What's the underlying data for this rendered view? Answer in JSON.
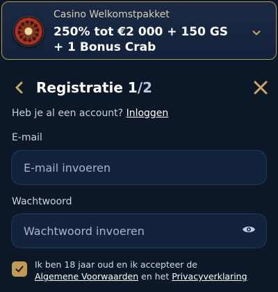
{
  "bonus": {
    "label": "Casino Welkomstpakket",
    "title": "250% tot €2 000 + 150 GS + 1 Bonus Crab",
    "image_icon": "roulette-wheel-icon",
    "toggle_icon": "chevron-down-icon"
  },
  "header": {
    "back_icon": "chevron-left-icon",
    "title": "Registratie 1",
    "step_separator": "/",
    "step_total": "2",
    "close_icon": "close-icon"
  },
  "account": {
    "question": "Heb je al een account?",
    "login_link": "Inloggen"
  },
  "form": {
    "email": {
      "label": "E-mail",
      "placeholder": "E-mail invoeren",
      "value": ""
    },
    "password": {
      "label": "Wachtwoord",
      "placeholder": "Wachtwoord invoeren",
      "value": "",
      "toggle_icon": "eye-icon"
    }
  },
  "consent": {
    "checked": true,
    "text_start": "Ik ben 18 jaar oud en ik accepteer de",
    "terms_link": "Algemene Voorwaarden",
    "text_middle": "en het",
    "privacy_link": "Privacyverklaring"
  },
  "colors": {
    "background": "#0c1728",
    "accent_gold": "#bf9a55",
    "input_bg": "#14233d",
    "input_border": "#22385a"
  }
}
